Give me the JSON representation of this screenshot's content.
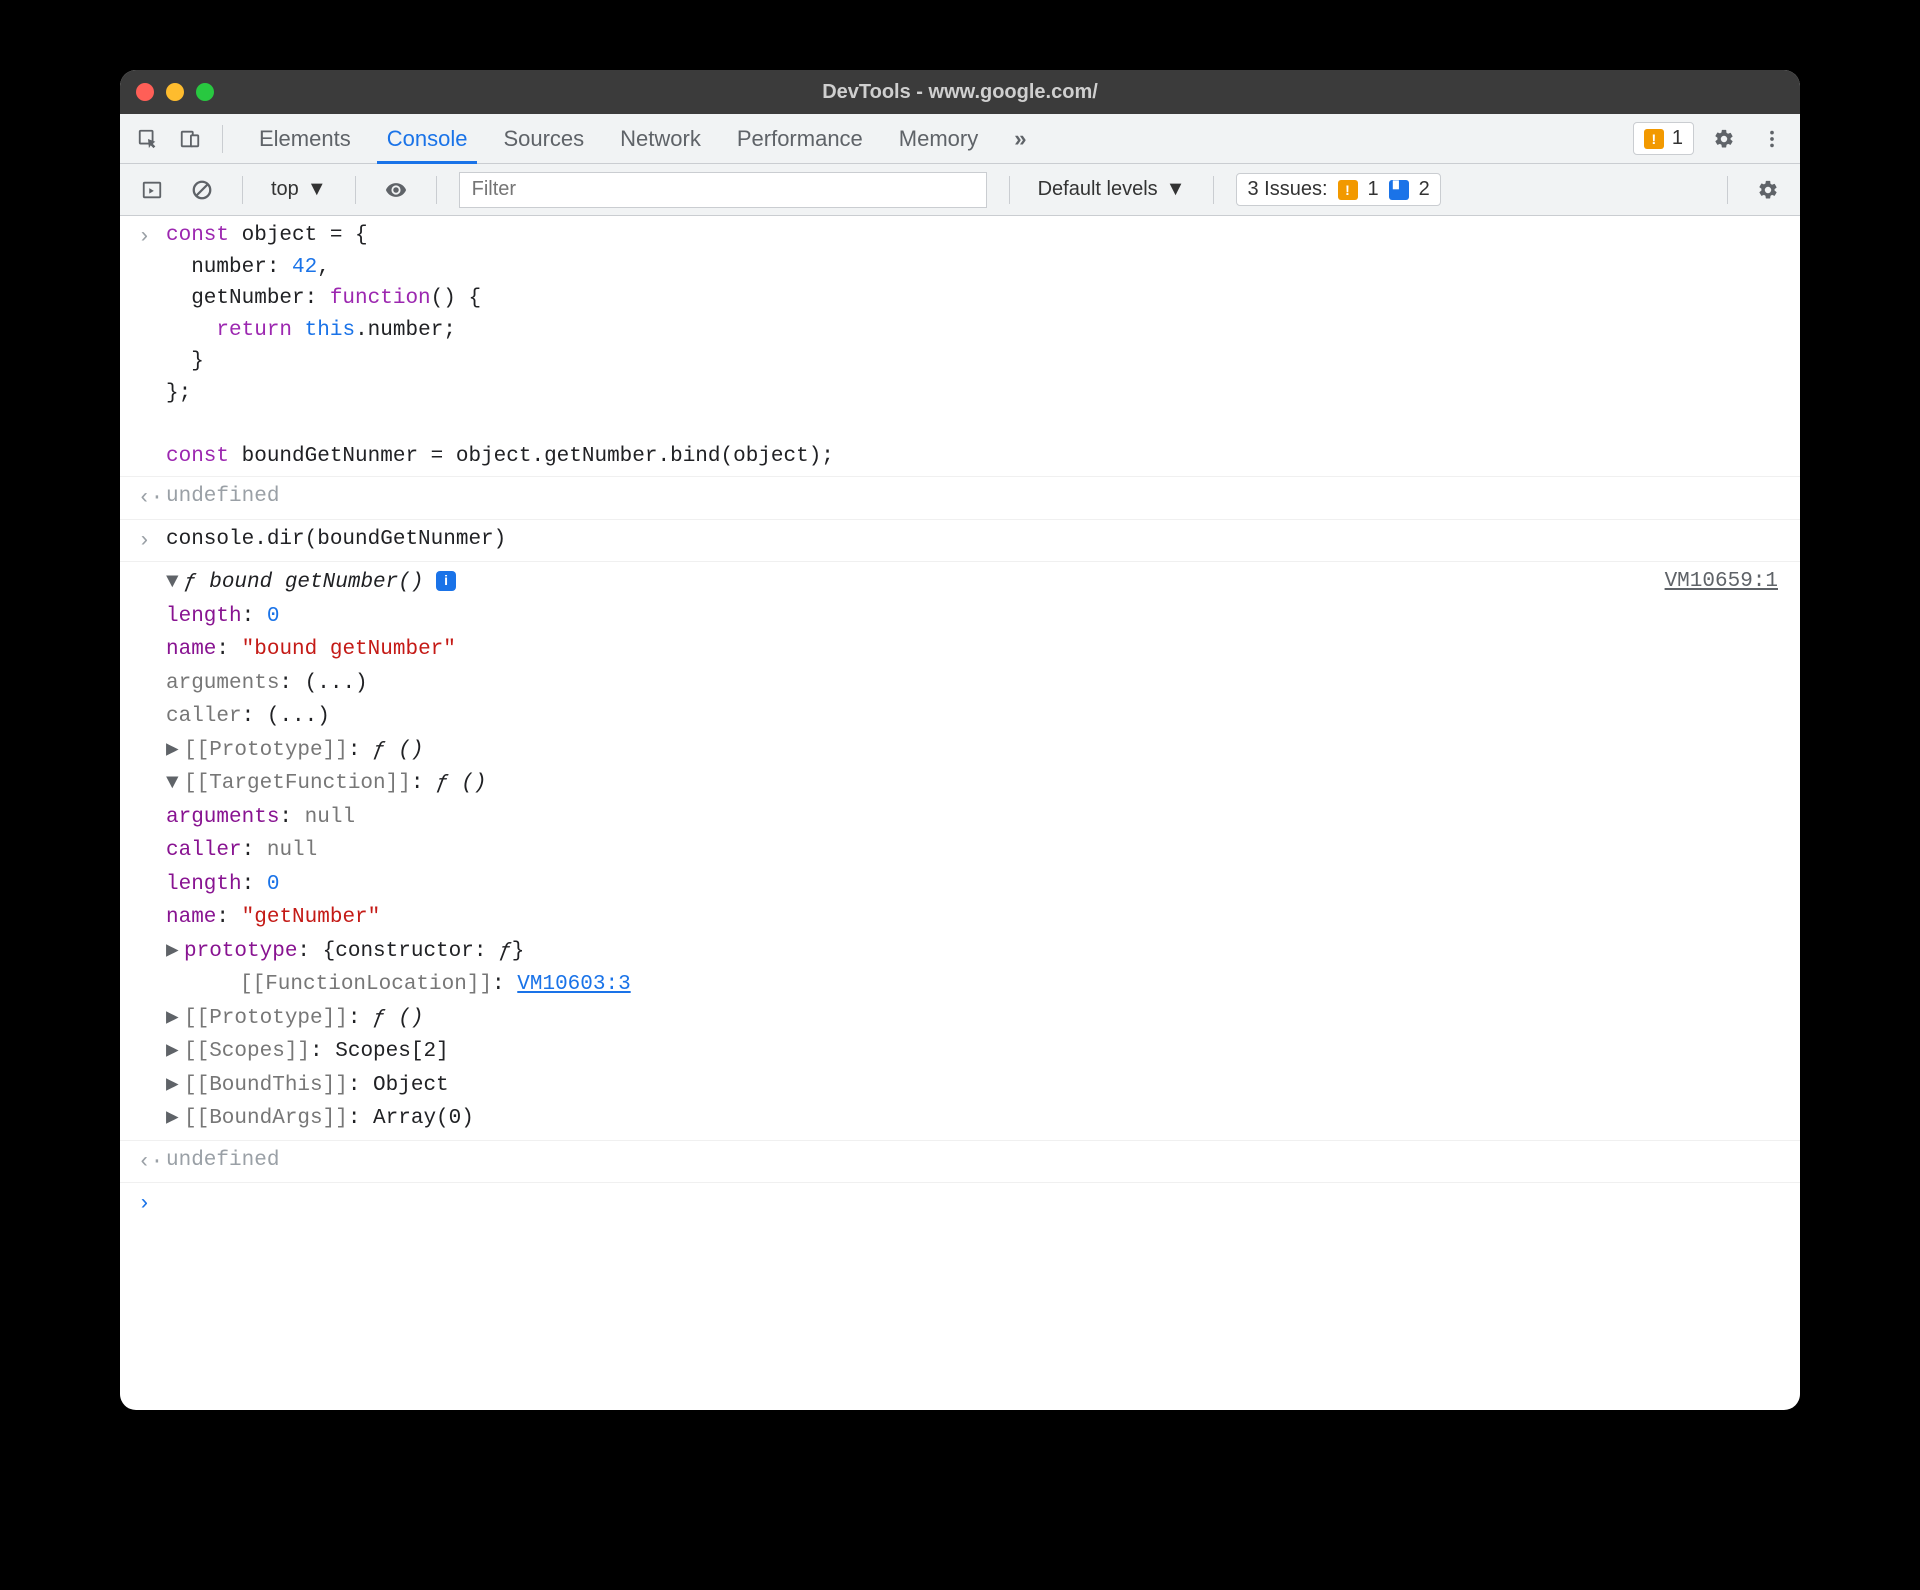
{
  "window": {
    "title": "DevTools - www.google.com/"
  },
  "tabs": {
    "items": [
      "Elements",
      "Console",
      "Sources",
      "Network",
      "Performance",
      "Memory"
    ],
    "warn_count": "1"
  },
  "toolbar": {
    "context": "top",
    "filter_placeholder": "Filter",
    "levels": "Default levels",
    "issues_label": "3 Issues:",
    "issues_warn": "1",
    "issues_info": "2"
  },
  "code": {
    "input1": "const object = {\n  number: 42,\n  getNumber: function() {\n    return this.number;\n  }\n};\n\nconst boundGetNunmer = object.getNumber.bind(object);",
    "result1": "undefined",
    "input2": "console.dir(boundGetNunmer)",
    "result2": "undefined"
  },
  "dir": {
    "src_link": "VM10659:1",
    "header_f": "ƒ",
    "header_name": "bound getNumber()",
    "length_k": "length",
    "length_v": "0",
    "name_k": "name",
    "name_v": "\"bound getNumber\"",
    "arguments_k": "arguments",
    "arguments_v": "(...)",
    "caller_k": "caller",
    "caller_v": "(...)",
    "proto_k": "[[Prototype]]",
    "proto_v": "ƒ ()",
    "target_k": "[[TargetFunction]]",
    "target_v": "ƒ ()",
    "t_arguments_k": "arguments",
    "t_arguments_v": "null",
    "t_caller_k": "caller",
    "t_caller_v": "null",
    "t_length_k": "length",
    "t_length_v": "0",
    "t_name_k": "name",
    "t_name_v": "\"getNumber\"",
    "t_proto_k": "prototype",
    "t_proto_v": "{constructor: ƒ}",
    "t_loc_k": "[[FunctionLocation]]",
    "t_loc_v": "VM10603:3",
    "t_iproto_k": "[[Prototype]]",
    "t_iproto_v": "ƒ ()",
    "t_scopes_k": "[[Scopes]]",
    "t_scopes_v": "Scopes[2]",
    "bthis_k": "[[BoundThis]]",
    "bthis_v": "Object",
    "bargs_k": "[[BoundArgs]]",
    "bargs_v": "Array(0)"
  }
}
